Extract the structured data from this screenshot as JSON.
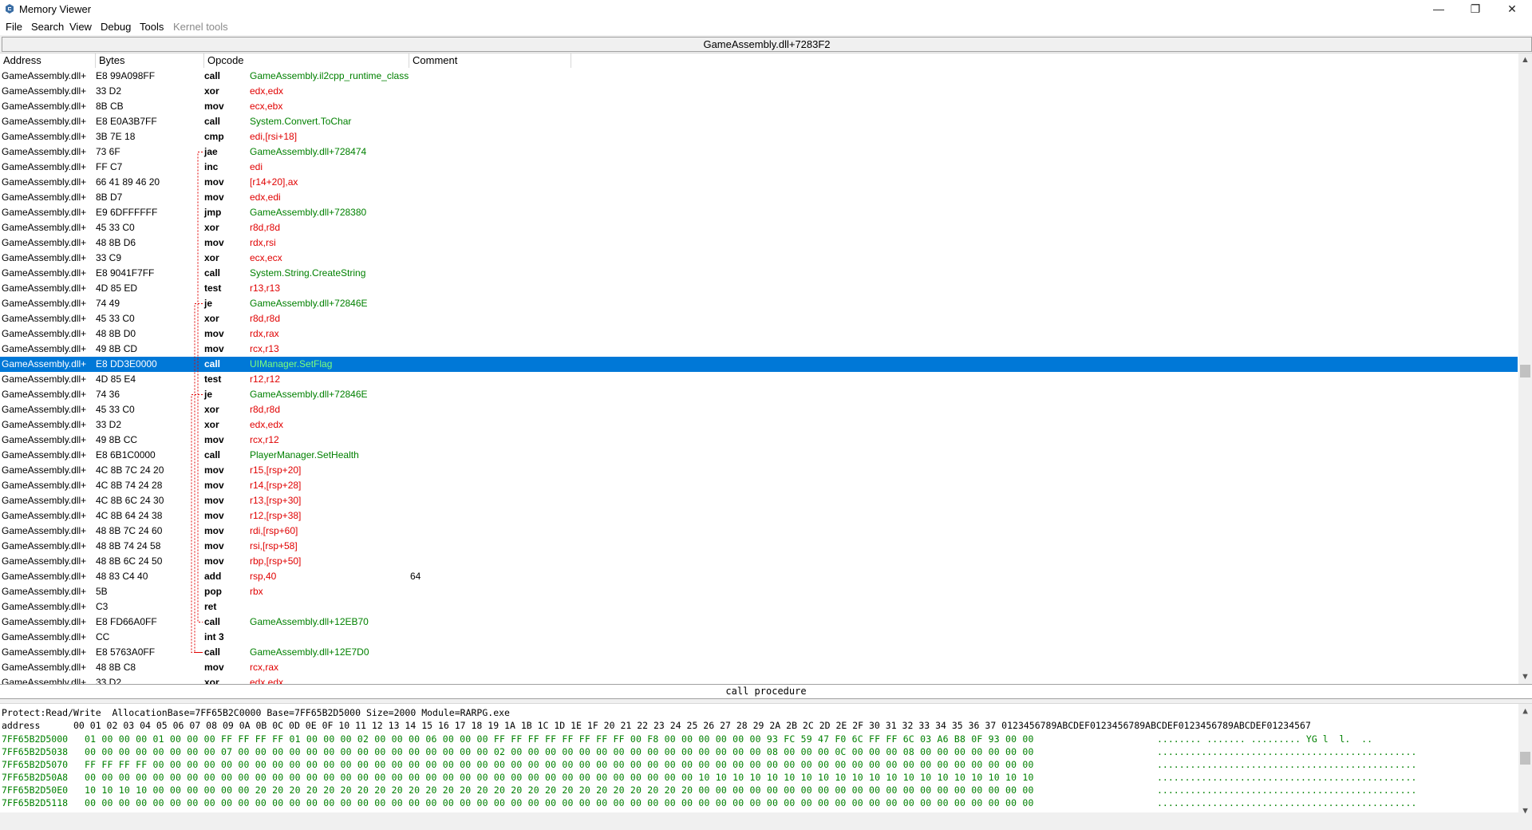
{
  "window": {
    "title": "Memory Viewer",
    "minimize": "—",
    "maximize": "❐",
    "close": "✕"
  },
  "menu": [
    {
      "label": "File"
    },
    {
      "label": "Search"
    },
    {
      "label": "View"
    },
    {
      "label": "Debug"
    },
    {
      "label": "Tools"
    },
    {
      "label": "Kernel tools"
    }
  ],
  "address_bar": "GameAssembly.dll+7283F2",
  "columns": {
    "address": "Address",
    "bytes": "Bytes",
    "opcode": "Opcode",
    "comment": "Comment"
  },
  "rows": [
    {
      "addr": "GameAssembly.dll+",
      "bytes": "E8 99A098FF",
      "op": "call",
      "args": "GameAssembly.il2cpp_runtime_class",
      "style": "green"
    },
    {
      "addr": "GameAssembly.dll+",
      "bytes": "33 D2",
      "op": "xor",
      "args": "edx,edx",
      "style": "red"
    },
    {
      "addr": "GameAssembly.dll+",
      "bytes": "8B CB",
      "op": "mov",
      "args": "ecx,ebx",
      "style": "red"
    },
    {
      "addr": "GameAssembly.dll+",
      "bytes": "E8 E0A3B7FF",
      "op": "call",
      "args": "System.Convert.ToChar",
      "style": "green"
    },
    {
      "addr": "GameAssembly.dll+",
      "bytes": "3B 7E 18",
      "op": "cmp",
      "args": "edi,[rsi+18]",
      "style": "red"
    },
    {
      "addr": "GameAssembly.dll+",
      "bytes": "73 6F",
      "op": "jae",
      "args": "GameAssembly.dll+728474",
      "style": "green"
    },
    {
      "addr": "GameAssembly.dll+",
      "bytes": "FF C7",
      "op": "inc",
      "args": "edi",
      "style": "red"
    },
    {
      "addr": "GameAssembly.dll+",
      "bytes": "66 41 89 46 20",
      "op": "mov",
      "args": "[r14+20],ax",
      "style": "red"
    },
    {
      "addr": "GameAssembly.dll+",
      "bytes": "8B D7",
      "op": "mov",
      "args": "edx,edi",
      "style": "red"
    },
    {
      "addr": "GameAssembly.dll+",
      "bytes": "E9 6DFFFFFF",
      "op": "jmp",
      "args": "GameAssembly.dll+728380",
      "style": "green"
    },
    {
      "addr": "GameAssembly.dll+",
      "bytes": "45 33 C0",
      "op": "xor",
      "args": "r8d,r8d",
      "style": "red"
    },
    {
      "addr": "GameAssembly.dll+",
      "bytes": "48 8B D6",
      "op": "mov",
      "args": "rdx,rsi",
      "style": "red"
    },
    {
      "addr": "GameAssembly.dll+",
      "bytes": "33 C9",
      "op": "xor",
      "args": "ecx,ecx",
      "style": "red"
    },
    {
      "addr": "GameAssembly.dll+",
      "bytes": "E8 9041F7FF",
      "op": "call",
      "args": "System.String.CreateString",
      "style": "green"
    },
    {
      "addr": "GameAssembly.dll+",
      "bytes": "4D 85 ED",
      "op": "test",
      "args": "r13,r13",
      "style": "red"
    },
    {
      "addr": "GameAssembly.dll+",
      "bytes": "74 49",
      "op": "je",
      "args": "GameAssembly.dll+72846E",
      "style": "green"
    },
    {
      "addr": "GameAssembly.dll+",
      "bytes": "45 33 C0",
      "op": "xor",
      "args": "r8d,r8d",
      "style": "red"
    },
    {
      "addr": "GameAssembly.dll+",
      "bytes": "48 8B D0",
      "op": "mov",
      "args": "rdx,rax",
      "style": "red"
    },
    {
      "addr": "GameAssembly.dll+",
      "bytes": "49 8B CD",
      "op": "mov",
      "args": "rcx,r13",
      "style": "red"
    },
    {
      "addr": "GameAssembly.dll+",
      "bytes": "E8 DD3E0000",
      "op": "call",
      "args": "UIManager.SetFlag",
      "style": "green",
      "selected": true
    },
    {
      "addr": "GameAssembly.dll+",
      "bytes": "4D 85 E4",
      "op": "test",
      "args": "r12,r12",
      "style": "red"
    },
    {
      "addr": "GameAssembly.dll+",
      "bytes": "74 36",
      "op": "je",
      "args": "GameAssembly.dll+72846E",
      "style": "green"
    },
    {
      "addr": "GameAssembly.dll+",
      "bytes": "45 33 C0",
      "op": "xor",
      "args": "r8d,r8d",
      "style": "red"
    },
    {
      "addr": "GameAssembly.dll+",
      "bytes": "33 D2",
      "op": "xor",
      "args": "edx,edx",
      "style": "red"
    },
    {
      "addr": "GameAssembly.dll+",
      "bytes": "49 8B CC",
      "op": "mov",
      "args": "rcx,r12",
      "style": "red"
    },
    {
      "addr": "GameAssembly.dll+",
      "bytes": "E8 6B1C0000",
      "op": "call",
      "args": "PlayerManager.SetHealth",
      "style": "green"
    },
    {
      "addr": "GameAssembly.dll+",
      "bytes": "4C 8B 7C 24 20",
      "op": "mov",
      "args": "r15,[rsp+20]",
      "style": "red"
    },
    {
      "addr": "GameAssembly.dll+",
      "bytes": "4C 8B 74 24 28",
      "op": "mov",
      "args": "r14,[rsp+28]",
      "style": "red"
    },
    {
      "addr": "GameAssembly.dll+",
      "bytes": "4C 8B 6C 24 30",
      "op": "mov",
      "args": "r13,[rsp+30]",
      "style": "red"
    },
    {
      "addr": "GameAssembly.dll+",
      "bytes": "4C 8B 64 24 38",
      "op": "mov",
      "args": "r12,[rsp+38]",
      "style": "red"
    },
    {
      "addr": "GameAssembly.dll+",
      "bytes": "48 8B 7C 24 60",
      "op": "mov",
      "args": "rdi,[rsp+60]",
      "style": "red"
    },
    {
      "addr": "GameAssembly.dll+",
      "bytes": "48 8B 74 24 58",
      "op": "mov",
      "args": "rsi,[rsp+58]",
      "style": "red"
    },
    {
      "addr": "GameAssembly.dll+",
      "bytes": "48 8B 6C 24 50",
      "op": "mov",
      "args": "rbp,[rsp+50]",
      "style": "red"
    },
    {
      "addr": "GameAssembly.dll+",
      "bytes": "48 83 C4 40",
      "op": "add",
      "args": "rsp,40",
      "style": "red",
      "comment": "64"
    },
    {
      "addr": "GameAssembly.dll+",
      "bytes": "5B",
      "op": "pop",
      "args": "rbx",
      "style": "red"
    },
    {
      "addr": "GameAssembly.dll+",
      "bytes": "C3",
      "op": "ret",
      "args": "",
      "style": "red"
    },
    {
      "addr": "GameAssembly.dll+",
      "bytes": "E8 FD66A0FF",
      "op": "call",
      "args": "GameAssembly.dll+12EB70",
      "style": "green"
    },
    {
      "addr": "GameAssembly.dll+",
      "bytes": "CC",
      "op": "int 3",
      "args": "",
      "style": "red"
    },
    {
      "addr": "GameAssembly.dll+",
      "bytes": "E8 5763A0FF",
      "op": "call",
      "args": "GameAssembly.dll+12E7D0",
      "style": "green"
    },
    {
      "addr": "GameAssembly.dll+",
      "bytes": "48 8B C8",
      "op": "mov",
      "args": "rcx,rax",
      "style": "red"
    },
    {
      "addr": "GameAssembly.dll+",
      "bytes": "33 D2",
      "op": "xor",
      "args": "edx,edx",
      "style": "red"
    }
  ],
  "status_text": "call procedure",
  "hex": {
    "info": "Protect:Read/Write  AllocationBase=7FF65B2C0000 Base=7FF65B2D5000 Size=2000 Module=RARPG.exe",
    "header": "address      00 01 02 03 04 05 06 07 08 09 0A 0B 0C 0D 0E 0F 10 11 12 13 14 15 16 17 18 19 1A 1B 1C 1D 1E 1F 20 21 22 23 24 25 26 27 28 29 2A 2B 2C 2D 2E 2F 30 31 32 33 34 35 36 37 0123456789ABCDEF0123456789ABCDEF0123456789ABCDEF01234567",
    "rows": [
      {
        "addr": "7FF65B2D5000",
        "bytes": "01 00 00 00 01 00 00 00 FF FF FF FF 01 00 00 00 02 00 00 00 06 00 00 00 FF FF FF FF FF FF FF FF 00 F8 00 00 00 00 00 00 93 FC 59 47 F0 6C FF FF 6C 03 A6 B8 0F 93 00 00",
        "ascii": "........ ....... ......... YG l  l.  .."
      },
      {
        "addr": "7FF65B2D5038",
        "bytes": "00 00 00 00 00 00 00 00 07 00 00 00 00 00 00 00 00 00 00 00 00 00 00 00 02 00 00 00 00 00 00 00 00 00 00 00 00 00 00 00 08 00 00 00 0C 00 00 00 08 00 00 00 00 00 00 00",
        "ascii": "..............................................."
      },
      {
        "addr": "7FF65B2D5070",
        "bytes": "FF FF FF FF 00 00 00 00 00 00 00 00 00 00 00 00 00 00 00 00 00 00 00 00 00 00 00 00 00 00 00 00 00 00 00 00 00 00 00 00 00 00 00 00 00 00 00 00 00 00 00 00 00 00 00 00",
        "ascii": "..............................................."
      },
      {
        "addr": "7FF65B2D50A8",
        "bytes": "00 00 00 00 00 00 00 00 00 00 00 00 00 00 00 00 00 00 00 00 00 00 00 00 00 00 00 00 00 00 00 00 00 00 00 00 10 10 10 10 10 10 10 10 10 10 10 10 10 10 10 10 10 10 10 10",
        "ascii": "..............................................."
      },
      {
        "addr": "7FF65B2D50E0",
        "bytes": "10 10 10 10 00 00 00 00 00 00 20 20 20 20 20 20 20 20 20 20 20 20 20 20 20 20 20 20 20 20 20 20 20 20 20 20 00 00 00 00 00 00 00 00 00 00 00 00 00 00 00 00 00 00 00 00",
        "ascii": "..............................................."
      },
      {
        "addr": "7FF65B2D5118",
        "bytes": "00 00 00 00 00 00 00 00 00 00 00 00 00 00 00 00 00 00 00 00 00 00 00 00 00 00 00 00 00 00 00 00 00 00 00 00 00 00 00 00 00 00 00 00 00 00 00 00 00 00 00 00 00 00 00 00",
        "ascii": "..............................................."
      }
    ]
  },
  "colors": {
    "selection": "#0078d7",
    "green": "#008000",
    "red": "#e00000",
    "blue": "#0000ff",
    "jump_line": "#e00000"
  }
}
